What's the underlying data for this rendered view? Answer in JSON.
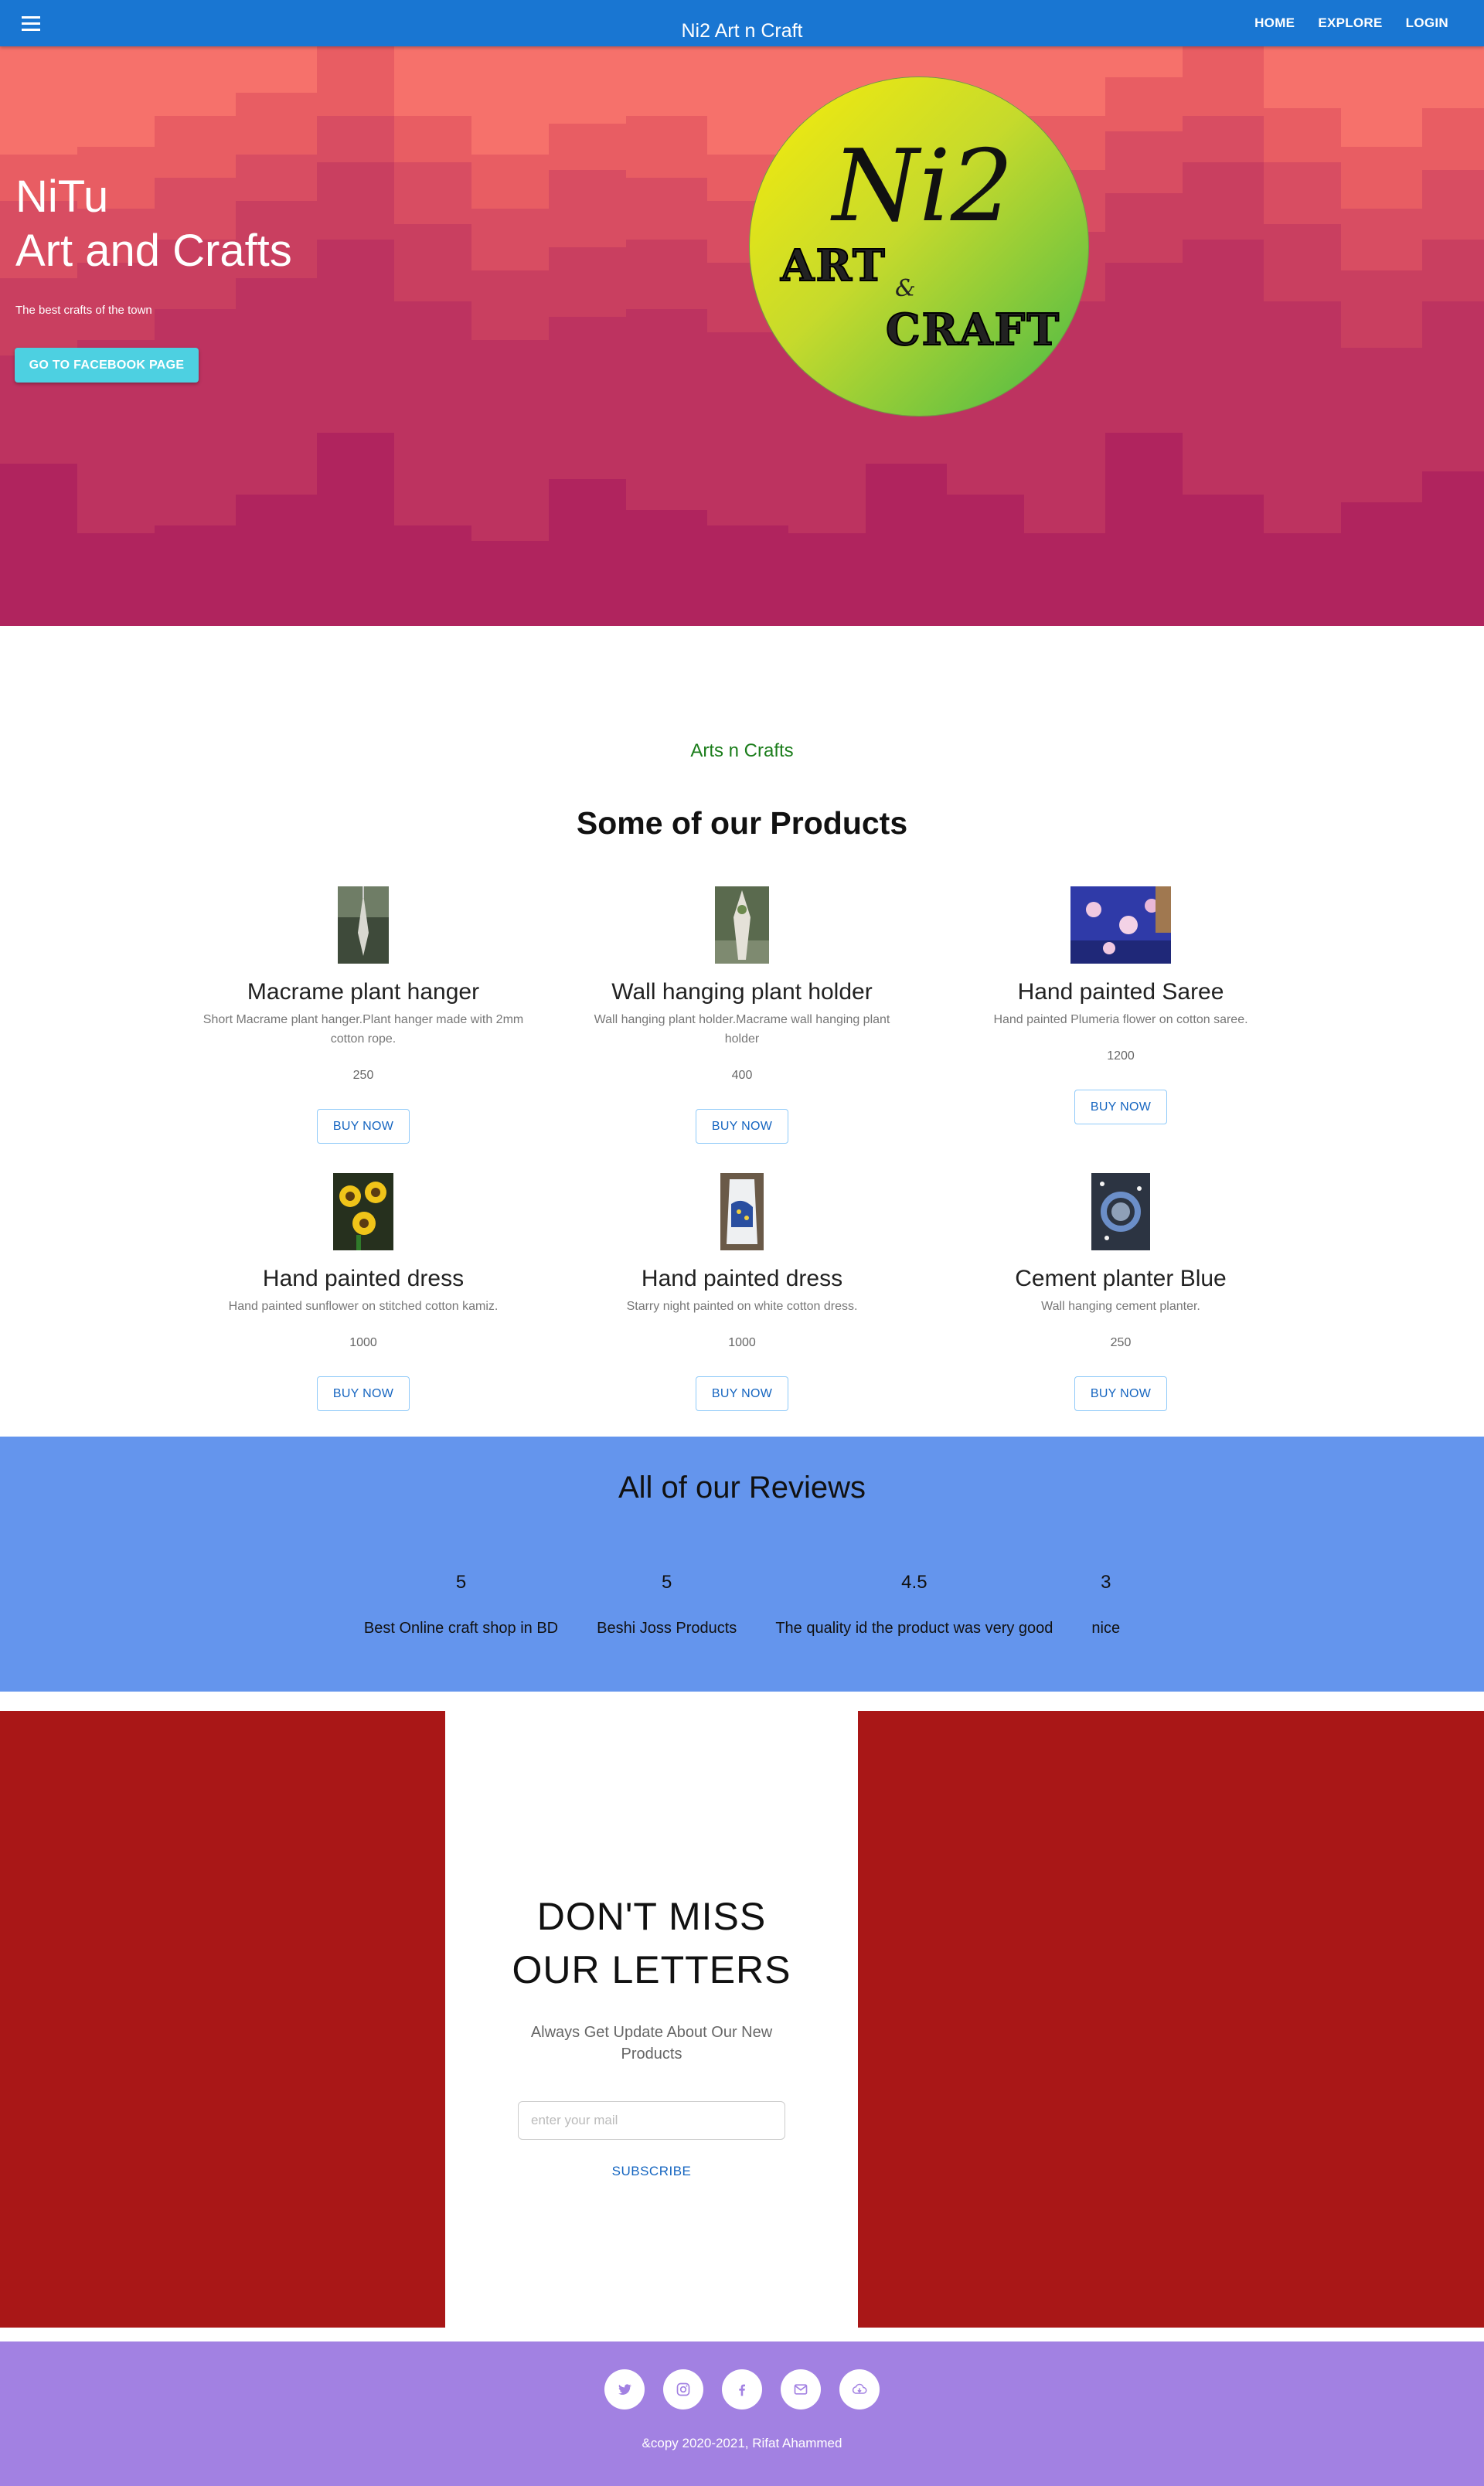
{
  "header": {
    "brand": "Ni2 Art n Craft",
    "menu_icon": "hamburger-menu-icon",
    "nav": [
      {
        "label": "HOME"
      },
      {
        "label": "EXPLORE"
      },
      {
        "label": "LOGIN"
      }
    ]
  },
  "hero": {
    "title_line1": "NiTu",
    "title_line2": "Art and Crafts",
    "subtitle": "The best crafts of the town",
    "button": "GO TO FACEBOOK PAGE",
    "logo": {
      "title": "Ni2",
      "line1": "ART",
      "ampersand": "&",
      "line2": "CRAFT"
    }
  },
  "products": {
    "kicker": "Arts n Crafts",
    "title": "Some of our Products",
    "buy_label": "BUY NOW",
    "items": [
      {
        "name": "Macrame plant hanger",
        "description": "Short Macrame plant hanger.Plant hanger made with 2mm cotton rope.",
        "price": "250"
      },
      {
        "name": "Wall hanging plant holder",
        "description": "Wall hanging plant holder.Macrame wall hanging plant holder",
        "price": "400"
      },
      {
        "name": "Hand painted Saree",
        "description": "Hand painted Plumeria flower on cotton saree.",
        "price": "1200"
      },
      {
        "name": "Hand painted dress",
        "description": "Hand painted sunflower on stitched cotton kamiz.",
        "price": "1000"
      },
      {
        "name": "Hand painted dress",
        "description": "Starry night painted on white cotton dress.",
        "price": "1000"
      },
      {
        "name": "Cement planter Blue",
        "description": "Wall hanging cement planter.",
        "price": "250"
      }
    ]
  },
  "reviews": {
    "title": "All of our Reviews",
    "items": [
      {
        "rating": "5",
        "text": "Best Online craft shop in BD"
      },
      {
        "rating": "5",
        "text": "Beshi Joss Products"
      },
      {
        "rating": "4.5",
        "text": "The quality id the product was very good"
      },
      {
        "rating": "3",
        "text": "nice"
      }
    ]
  },
  "newsletter": {
    "title_line1": "DON'T MISS",
    "title_line2": "OUR LETTERS",
    "subtitle": "Always Get Update About Our New Products",
    "input_placeholder": "enter your mail",
    "button": "SUBSCRIBE"
  },
  "footer": {
    "socials": [
      "twitter-icon",
      "instagram-icon",
      "facebook-icon",
      "email-icon",
      "download-icon"
    ],
    "copyright": "&copy 2020-2021, Rifat Ahammed"
  },
  "colors": {
    "topbar": "#1976d2",
    "reviews_bg": "#6495ed",
    "newsletter_panels": "#a91717",
    "footer_bg": "#a281e2",
    "kicker": "#1b7d1b",
    "fb_button": "#4dd0e1"
  }
}
